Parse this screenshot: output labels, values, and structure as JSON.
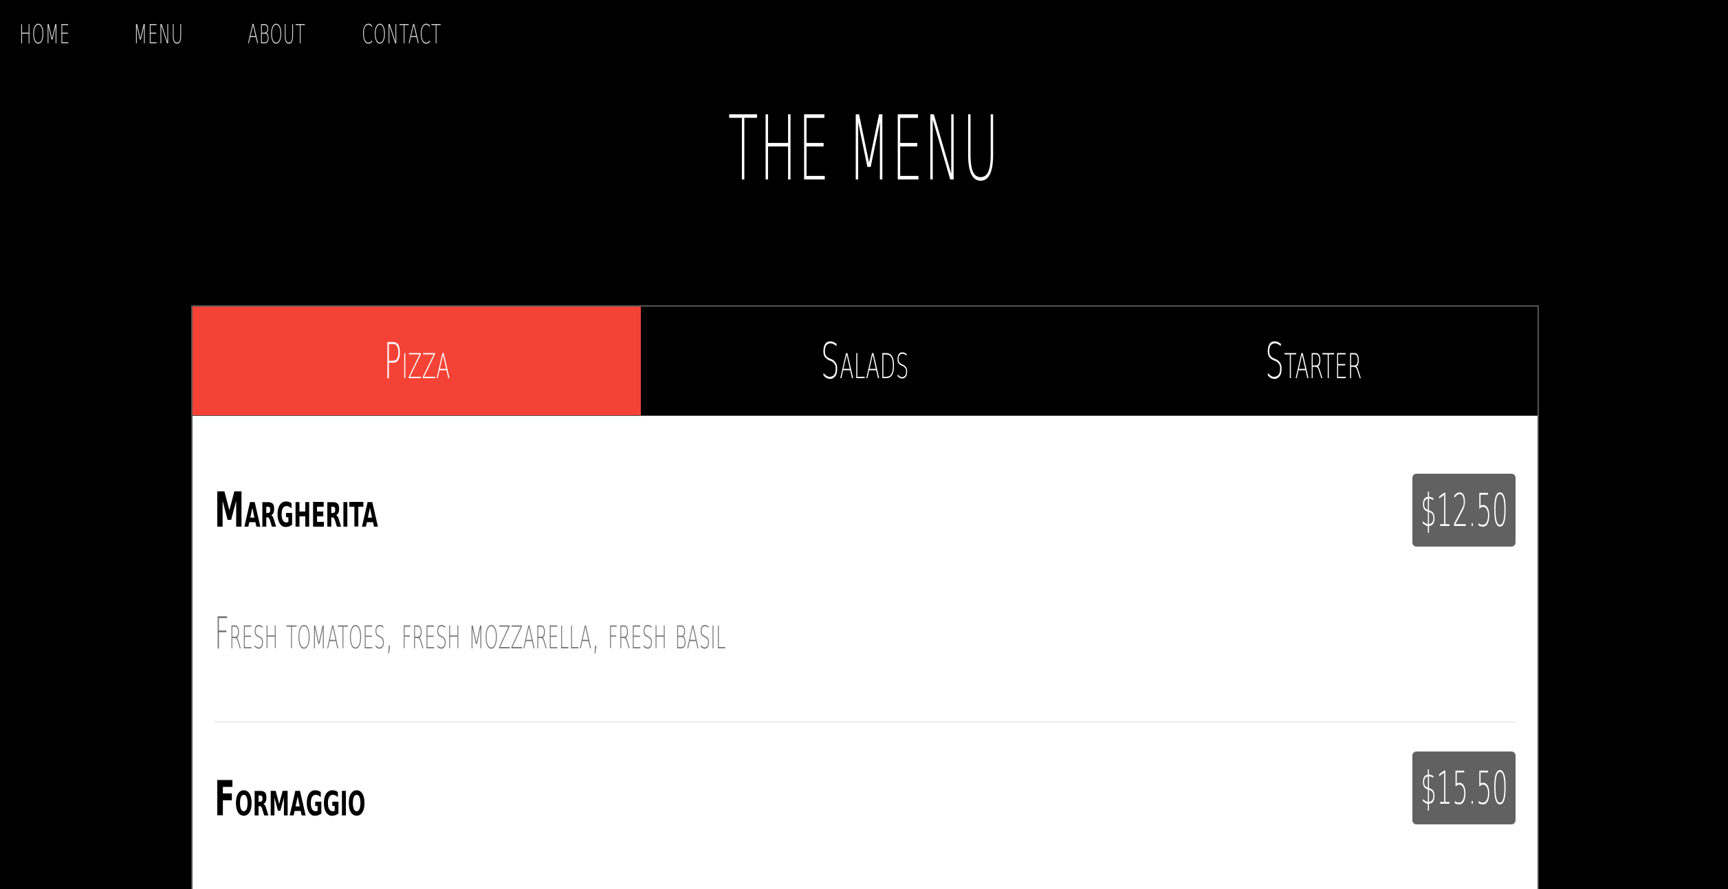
{
  "nav": {
    "items": [
      {
        "label": "HOME"
      },
      {
        "label": "MENU"
      },
      {
        "label": "ABOUT"
      },
      {
        "label": "CONTACT"
      }
    ]
  },
  "header": {
    "title": "THE MENU"
  },
  "tabs": [
    {
      "label": "Pizza",
      "active": true
    },
    {
      "label": "Salads",
      "active": false
    },
    {
      "label": "Starter",
      "active": false
    }
  ],
  "items": [
    {
      "name": "Margherita",
      "price": "$12.50",
      "description": "Fresh tomatoes, fresh mozzarella, fresh basil"
    },
    {
      "name": "Formaggio",
      "price": "$15.50"
    }
  ],
  "colors": {
    "background": "#000000",
    "active_tab": "#f44336",
    "price_badge": "#616161",
    "description_text": "#757575"
  }
}
